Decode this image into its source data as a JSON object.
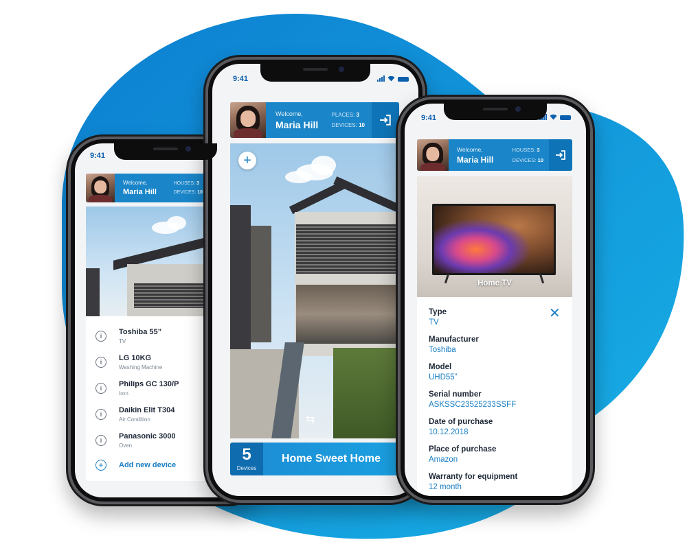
{
  "status": {
    "time": "9:41"
  },
  "user": {
    "welcome": "Welcome,",
    "name": "Maria Hill"
  },
  "left_phone": {
    "stats": [
      {
        "label": "HOUSES:",
        "value": "3"
      },
      {
        "label": "DEVICES:",
        "value": "10"
      }
    ],
    "devices": [
      {
        "name": "Toshiba 55”",
        "type": "TV"
      },
      {
        "name": "LG 10KG",
        "type": "Washing Machine"
      },
      {
        "name": "Philips GC 130/P",
        "type": "Iron"
      },
      {
        "name": "Daikin Elit T304",
        "type": "Air Condition"
      },
      {
        "name": "Panasonic 3000",
        "type": "Oven"
      }
    ],
    "add_label": "Add new device",
    "info_glyph": "i",
    "add_glyph": "+"
  },
  "middle_phone": {
    "stats": [
      {
        "label": "PLACES:",
        "value": "3"
      },
      {
        "label": "DEVICES:",
        "value": "10"
      }
    ],
    "plus_glyph": "+",
    "device_count": "5",
    "device_count_label": "Devices",
    "home_name": "Home Sweet Home"
  },
  "right_phone": {
    "stats": [
      {
        "label": "HOUSES:",
        "value": "3"
      },
      {
        "label": "DEVICES:",
        "value": "10"
      }
    ],
    "product_title": "Home TV",
    "close_glyph": "✕",
    "fields": [
      {
        "label": "Type",
        "value": "TV"
      },
      {
        "label": "Manufacturer",
        "value": "Toshiba"
      },
      {
        "label": "Model",
        "value": "UHD55”"
      },
      {
        "label": "Serial number",
        "value": "ASKSSC23525233SSFF"
      },
      {
        "label": "Date of purchase",
        "value": "10.12.2018"
      },
      {
        "label": "Place of purchase",
        "value": "Amazon"
      },
      {
        "label": "Warranty for equipment",
        "value": "12 month"
      }
    ]
  },
  "colors": {
    "accent": "#1a85c8",
    "accent_dark": "#0f6cae",
    "link": "#1a7fc4",
    "blob": "#0e8fd6"
  },
  "icons": [
    "logout-icon",
    "info-icon",
    "add-icon",
    "plus-icon",
    "swipe-icon",
    "close-icon",
    "signal-icon",
    "wifi-icon",
    "battery-icon"
  ]
}
